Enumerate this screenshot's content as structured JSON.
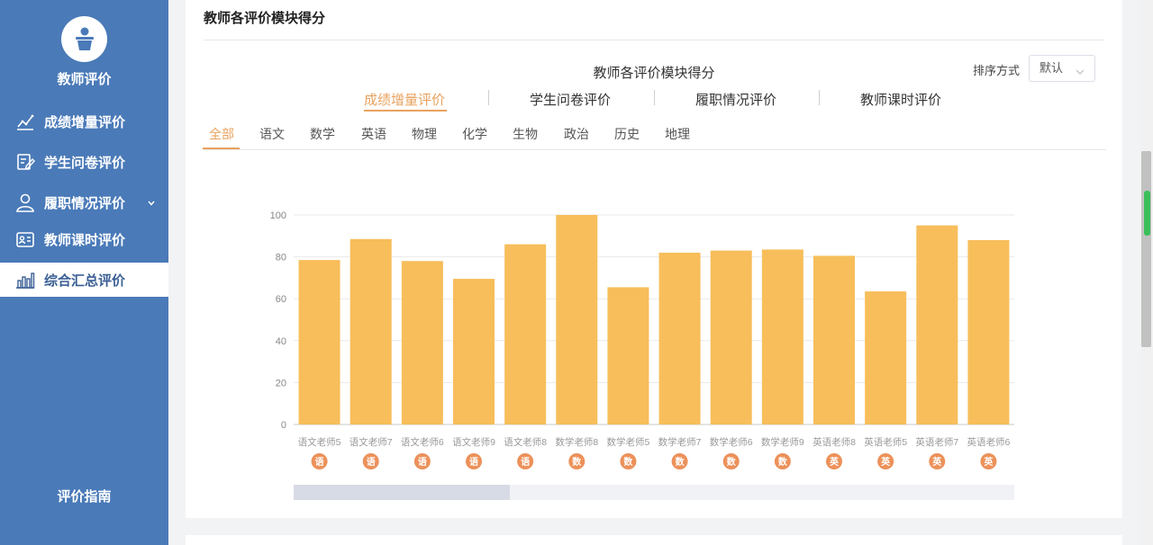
{
  "sidebar": {
    "title": "教师评价",
    "items": [
      {
        "label": "成绩增量评价",
        "icon": "line-chart-icon"
      },
      {
        "label": "学生问卷评价",
        "icon": "edit-form-icon"
      },
      {
        "label": "履职情况评价",
        "icon": "user-icon"
      },
      {
        "label": "教师课时评价",
        "icon": "id-card-icon"
      },
      {
        "label": "综合汇总评价",
        "icon": "bar-chart-icon"
      }
    ],
    "guide": "评价指南"
  },
  "panel": {
    "title": "教师各评价模块得分",
    "sort_label": "排序方式",
    "sort_value": "默认",
    "module_tabs": [
      "成绩增量评价",
      "学生问卷评价",
      "履职情况评价",
      "教师课时评价"
    ],
    "subject_tabs": [
      "全部",
      "语文",
      "数学",
      "英语",
      "物理",
      "化学",
      "生物",
      "政治",
      "历史",
      "地理"
    ]
  },
  "chart_data": {
    "type": "bar",
    "title": "教师各评价模块得分",
    "categories": [
      "语文老师5",
      "语文老师7",
      "语文老师6",
      "语文老师9",
      "语文老师8",
      "数学老师8",
      "数学老师5",
      "数学老师7",
      "数学老师6",
      "数学老师9",
      "英语老师8",
      "英语老师5",
      "英语老师7",
      "英语老师6"
    ],
    "badges": [
      "语",
      "语",
      "语",
      "语",
      "语",
      "数",
      "数",
      "数",
      "数",
      "数",
      "英",
      "英",
      "英",
      "英"
    ],
    "values": [
      78.5,
      88.5,
      78,
      69.5,
      86,
      100,
      65.5,
      82,
      83,
      83.5,
      80.5,
      63.5,
      95,
      88
    ],
    "ylim": [
      0,
      100
    ],
    "yticks": [
      "0",
      "20",
      "40",
      "60",
      "80",
      "100"
    ],
    "grid": true,
    "bar_color": "#f7be5b",
    "badge_color": "#ec915a"
  },
  "colors": {
    "sidebar": "#4a7ab8",
    "accent": "#e8a25e"
  }
}
